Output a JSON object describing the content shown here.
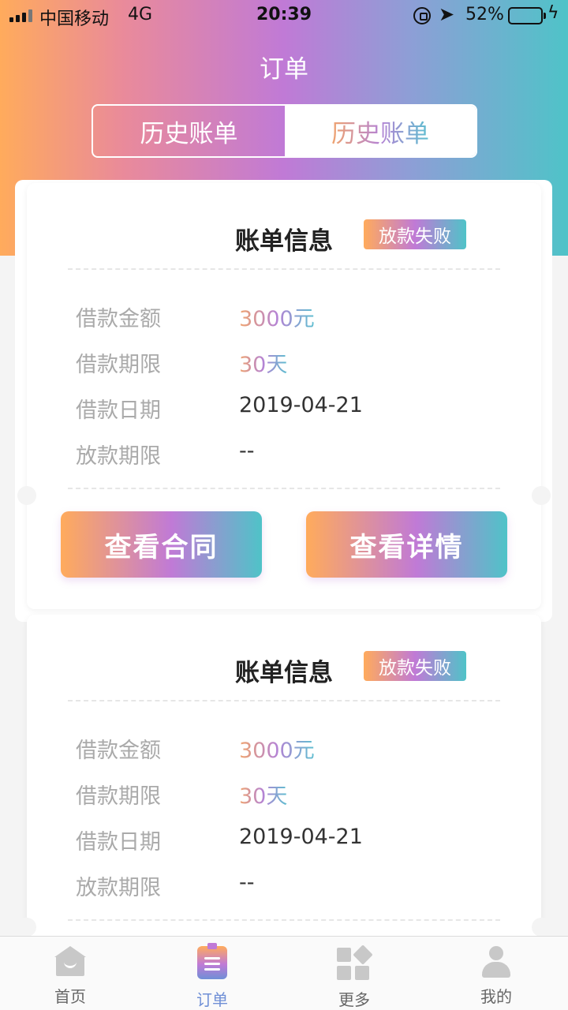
{
  "status_bar": {
    "carrier": "中国移动",
    "network": "4G",
    "time": "20:39",
    "battery_percent": "52%",
    "battery_level": 0.52
  },
  "header": {
    "title": "订单",
    "tabs": [
      {
        "label": "历史账单",
        "active": true
      },
      {
        "label": "历史账单",
        "active": false
      }
    ]
  },
  "bills": [
    {
      "title": "账单信息",
      "status": "放款失败",
      "rows": [
        {
          "label": "借款金额",
          "value": "3000元"
        },
        {
          "label": "借款期限",
          "value": "30天"
        },
        {
          "label": "借款日期",
          "value": "2019-04-21"
        },
        {
          "label": "放款期限",
          "value": "--"
        }
      ],
      "buttons": {
        "contract": "查看合同",
        "details": "查看详情"
      }
    },
    {
      "title": "账单信息",
      "status": "放款失败",
      "rows": [
        {
          "label": "借款金额",
          "value": "3000元"
        },
        {
          "label": "借款期限",
          "value": "30天"
        },
        {
          "label": "借款日期",
          "value": "2019-04-21"
        },
        {
          "label": "放款期限",
          "value": "--"
        }
      ]
    }
  ],
  "tabbar": {
    "items": [
      {
        "label": "首页",
        "icon": "home-icon"
      },
      {
        "label": "订单",
        "icon": "order-icon",
        "active": true
      },
      {
        "label": "更多",
        "icon": "grid-icon"
      },
      {
        "label": "我的",
        "icon": "user-icon"
      }
    ]
  },
  "colors": {
    "gradient_start": "#ffab5c",
    "gradient_mid": "#c07ad6",
    "gradient_end": "#4fc3c8",
    "active_tab": "#6f8fd6"
  }
}
